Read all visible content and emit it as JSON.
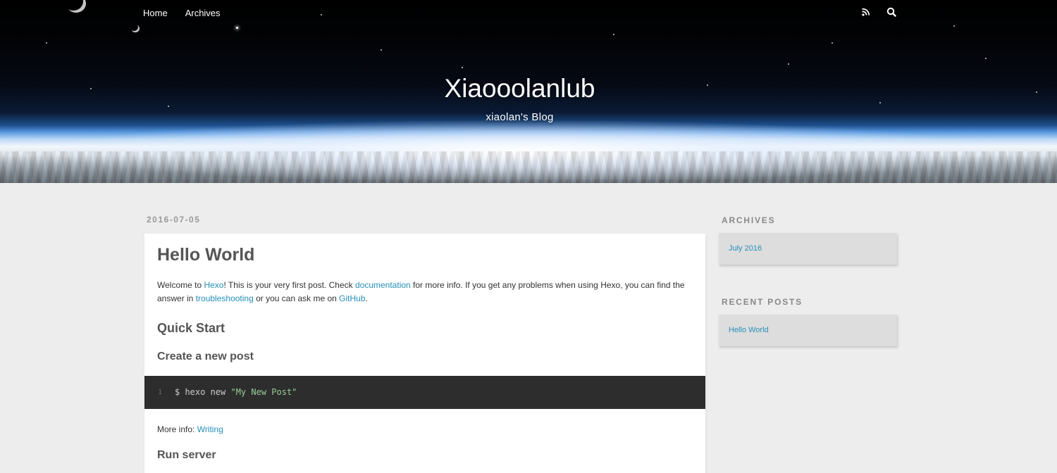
{
  "nav": {
    "main": [
      {
        "label": "Home"
      },
      {
        "label": "Archives"
      }
    ],
    "icons": [
      "rss-icon",
      "search-icon"
    ]
  },
  "banner": {
    "title": "Xiaooolanlub",
    "subtitle": "xiaolan's Blog"
  },
  "article": {
    "date": "2016-07-05",
    "title": "Hello World",
    "intro": {
      "t1": "Welcome to ",
      "link_hexo": "Hexo",
      "t2": "! This is your very first post. Check ",
      "link_docs": "documentation",
      "t3": " for more info. If you get any problems when using Hexo, you can find the answer in ",
      "link_trouble": "troubleshooting",
      "t4": " or you can ask me on ",
      "link_github": "GitHub",
      "t5": "."
    },
    "h_quick_start": "Quick Start",
    "h_create_post": "Create a new post",
    "code": {
      "line_number": "1",
      "command": "$ hexo new ",
      "string": "\"My New Post\""
    },
    "more_info_label": "More info: ",
    "more_info_link": "Writing",
    "h_run_server": "Run server"
  },
  "sidebar": {
    "archives_title": "ARCHIVES",
    "archives": [
      {
        "label": "July 2016"
      }
    ],
    "recent_title": "RECENT POSTS",
    "recent": [
      {
        "label": "Hello World"
      }
    ]
  },
  "colors": {
    "link": "#258fb8",
    "page_bg": "#ededed",
    "code_bg": "#2d2d2d",
    "code_string": "#99cc99"
  }
}
